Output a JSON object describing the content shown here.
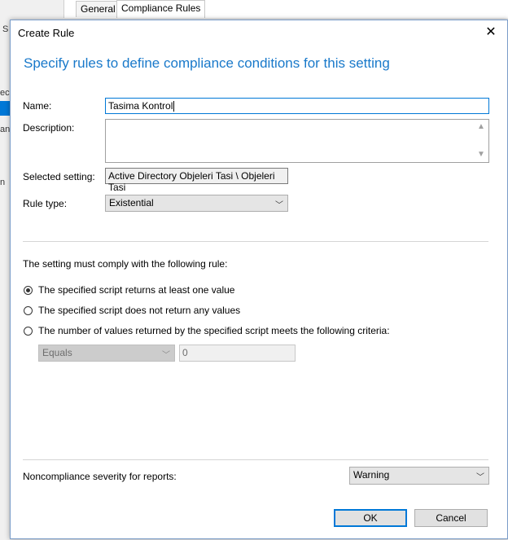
{
  "background": {
    "tabs": [
      "General",
      "Compliance Rules"
    ],
    "fragments": [
      "S",
      "ec",
      "an",
      "n"
    ]
  },
  "dialog": {
    "title": "Create Rule",
    "close_glyph": "✕",
    "heading": "Specify rules to define compliance conditions for this setting",
    "name": {
      "label": "Name:",
      "value": "Tasima Kontrol"
    },
    "description": {
      "label": "Description:",
      "value": ""
    },
    "selected_setting": {
      "label": "Selected setting:",
      "value": "Active Directory Objeleri Tasi \\ Objeleri Tasi"
    },
    "rule_type": {
      "label": "Rule type:",
      "value": "Existential"
    },
    "comply_label": "The setting must comply with the following rule:",
    "options": [
      {
        "label": "The specified script returns at least one value",
        "selected": true
      },
      {
        "label": "The specified script does not return any values",
        "selected": false
      },
      {
        "label": "The number of values returned by the specified script meets the following criteria:",
        "selected": false
      }
    ],
    "criteria": {
      "operator": "Equals",
      "value": "0"
    },
    "severity": {
      "label": "Noncompliance severity for reports:",
      "value": "Warning"
    },
    "buttons": {
      "ok": "OK",
      "cancel": "Cancel"
    }
  },
  "colors": {
    "accent": "#1979ca",
    "focus": "#0078d7"
  }
}
